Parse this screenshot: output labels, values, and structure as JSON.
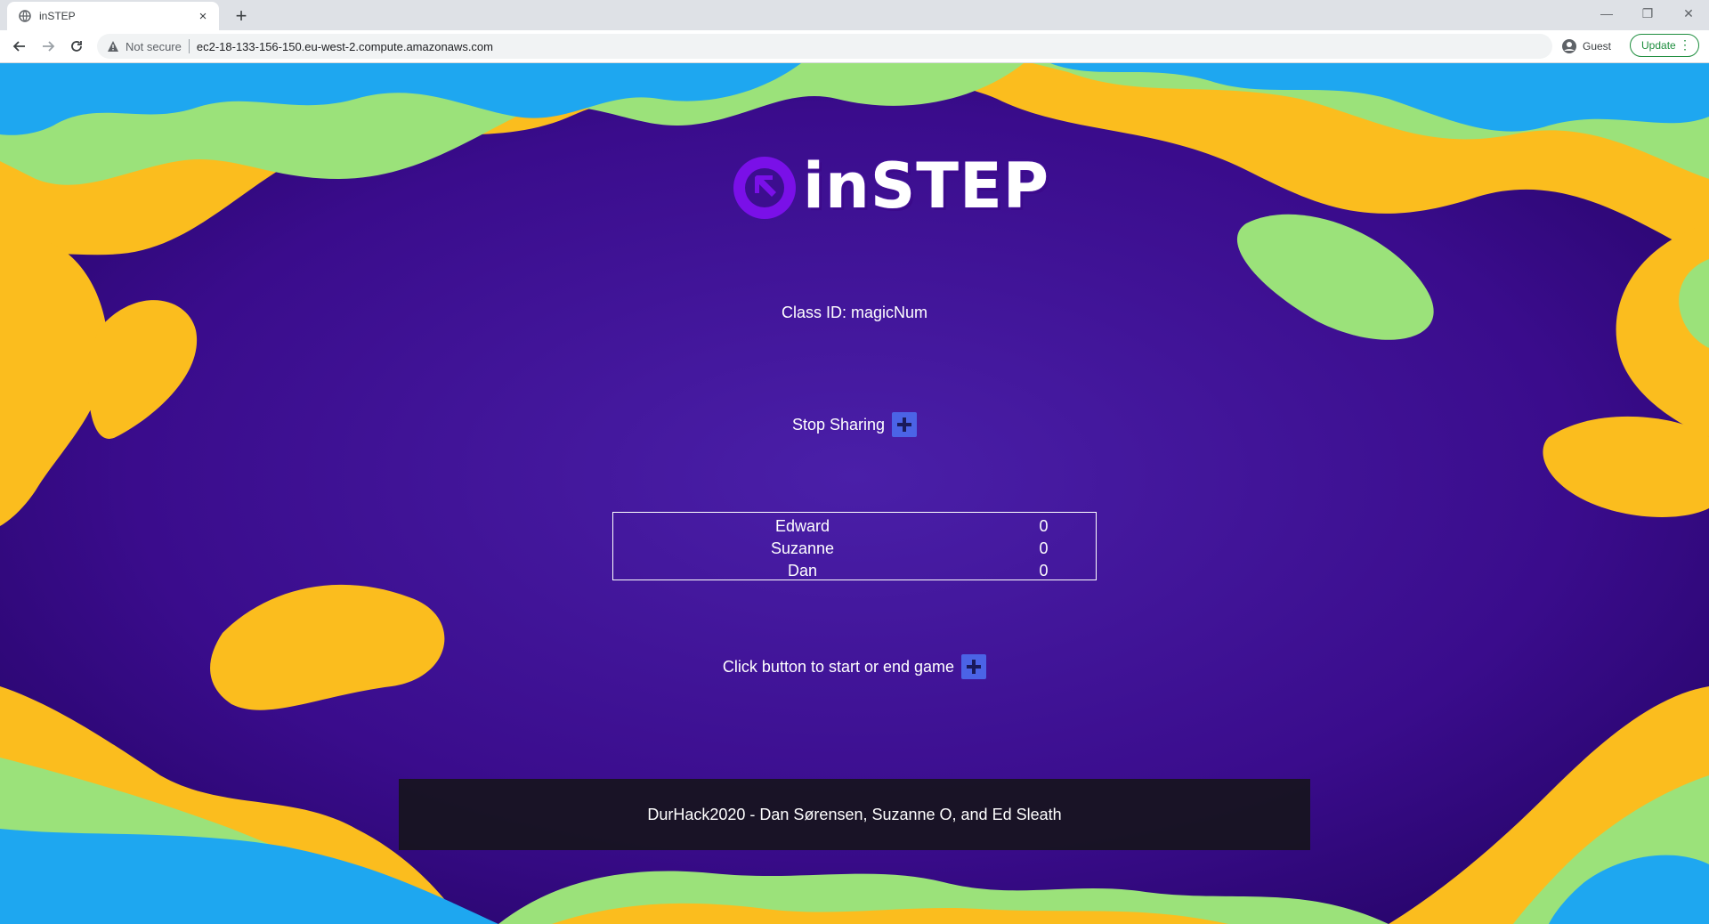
{
  "browser": {
    "tab_title": "inSTEP",
    "tab_close": "×",
    "new_tab": "+",
    "security_label": "Not secure",
    "url": "ec2-18-133-156-150.eu-west-2.compute.amazonaws.com",
    "profile_label": "Guest",
    "update_label": "Update",
    "update_menu": "⋮",
    "window_controls": {
      "minimize": "—",
      "restore": "❐",
      "close": "✕"
    }
  },
  "page": {
    "logo_text": "inSTEP",
    "class_id": "Class ID: magicNum",
    "sharing_label": "Stop Sharing",
    "game_label": "Click button to start or end game",
    "scoreboard": [
      {
        "name": "Edward",
        "score": "0"
      },
      {
        "name": "Suzanne",
        "score": "0"
      },
      {
        "name": "Dan",
        "score": "0"
      }
    ],
    "footer": "DurHack2020 - Dan Sørensen, Suzanne O, and Ed Sleath"
  },
  "colors": {
    "background_purple": "#3c0e8f",
    "blob_blue": "#1ea7f0",
    "blob_green": "#9be27a",
    "blob_yellow": "#fbbd1e",
    "plus_button": "#4b63e6",
    "logo_purple": "#7a10e8"
  },
  "icons": {
    "favicon": "globe-icon",
    "warning": "warning-icon",
    "back": "arrow-left-icon",
    "forward": "arrow-right-icon",
    "reload": "reload-icon",
    "profile": "account-circle-icon",
    "plus": "plus-icon"
  }
}
